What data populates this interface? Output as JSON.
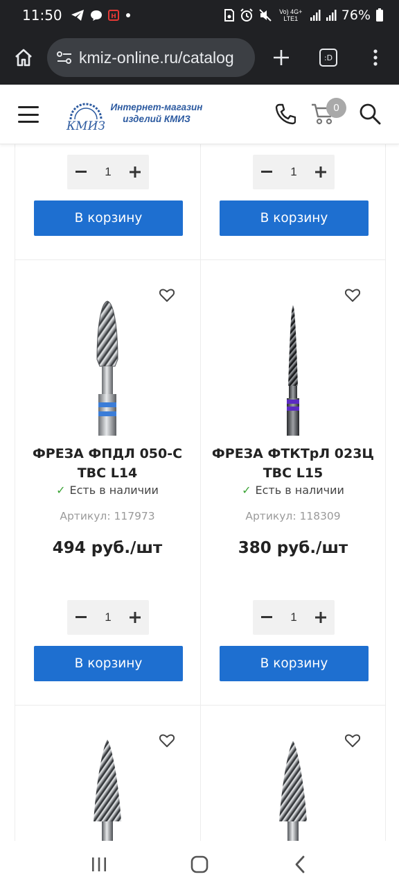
{
  "status_bar": {
    "time": "11:50",
    "battery": "76%",
    "network_label": "Vo) 4G+ LTE1",
    "left_icons": [
      "telegram-icon",
      "chat-bubble-icon",
      "news-app-icon",
      "dot-icon"
    ],
    "right_icons": [
      "save-icon",
      "alarm-icon",
      "mute-icon",
      "signal-icon",
      "signal-icon",
      "battery-icon"
    ]
  },
  "browser": {
    "url": "kmiz-online.ru/catalog",
    "tab_count_label": ":D"
  },
  "site_header": {
    "logo_text": "КМИЗ",
    "logo_tagline_1": "Интернет-магазин",
    "logo_tagline_2": "изделий КМИЗ",
    "cart_count": "0"
  },
  "catalog": {
    "top_row": [
      {
        "quantity": "1",
        "add_to_cart_label": "В корзину"
      },
      {
        "quantity": "1",
        "add_to_cart_label": "В корзину"
      }
    ],
    "products": [
      {
        "title": "ФРЕЗА ФПДЛ 050-С TBC L14",
        "stock": "Есть в наличии",
        "sku": "Артикул: 117973",
        "price": "494 руб./шт",
        "quantity": "1",
        "add_to_cart_label": "В корзину",
        "band_color": "#3b7dd8"
      },
      {
        "title": "ФРЕЗА ФТКТрЛ 023Ц TBC L15",
        "stock": "Есть в наличии",
        "sku": "Артикул: 118309",
        "price": "380 руб./шт",
        "quantity": "1",
        "add_to_cart_label": "В корзину",
        "band_color": "#5b2bc2"
      }
    ]
  },
  "colors": {
    "accent_blue": "#1e6fd0",
    "stock_green": "#3aa335",
    "browser_dark": "#202124"
  }
}
